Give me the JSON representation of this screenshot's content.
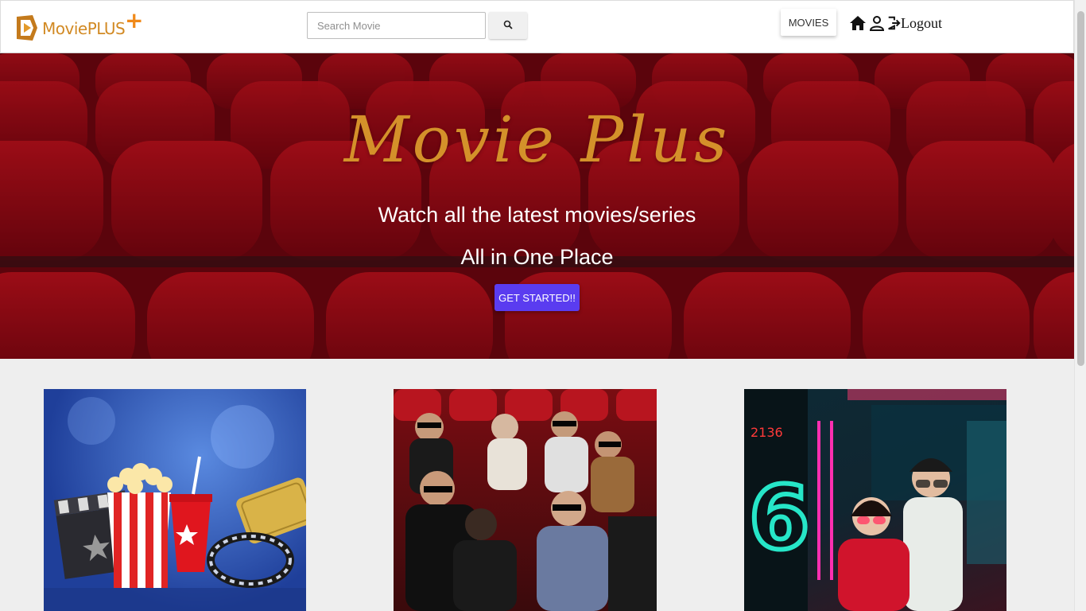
{
  "brand": {
    "name": "MoviePLUS",
    "plus_glyph": "+"
  },
  "search": {
    "placeholder": "Search Movie",
    "icon": "search-icon"
  },
  "nav": {
    "movies_label": "MOVIES",
    "home_icon": "home-icon",
    "user_icon": "user-icon",
    "logout_icon": "logout-icon",
    "logout_label": "Logout"
  },
  "hero": {
    "title": "Movie Plus",
    "subtitle_line1": "Watch all the latest movies/series",
    "subtitle_line2": "All in One Place",
    "cta_label": "GET STARTED!!"
  },
  "cards": [
    {
      "name": "popcorn-cinema-image"
    },
    {
      "name": "audience-3d-glasses-image"
    },
    {
      "name": "couple-neon-cinema-image"
    }
  ],
  "colors": {
    "accent": "#d4912a",
    "cta": "#5a3cf0",
    "hero_bg": "#8a0a12"
  }
}
